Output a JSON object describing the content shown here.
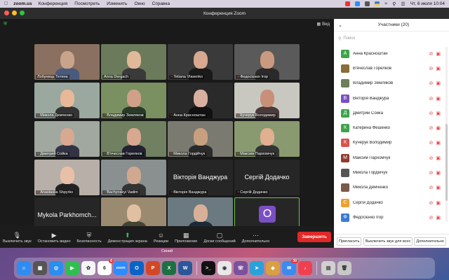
{
  "menubar": {
    "app": "zoom.us",
    "items": [
      "Конференция",
      "Посмотреть",
      "Изменить",
      "Окно",
      "Справка"
    ],
    "clock": "Чт, 6 июля 10:04"
  },
  "window": {
    "title": "Конференция Zoom",
    "view_label": "Вид"
  },
  "tiles": [
    {
      "name": "Лобунець Тетяна",
      "muted": false
    },
    {
      "name": "Anna Dergach",
      "muted": false
    },
    {
      "name": "Tetiana Vlasenko",
      "muted": true
    },
    {
      "name": "Федосієнко Ігор",
      "muted": true
    },
    {
      "name": "Микола Демченко",
      "muted": true
    },
    {
      "name": "Владимир Земляков",
      "muted": true
    },
    {
      "name": "Анна Красноштан",
      "muted": true
    },
    {
      "name": "Кучерук Володимир",
      "muted": true
    },
    {
      "name": "Дмитрий Сойка",
      "muted": true
    },
    {
      "name": "В'ячеслав Горелков",
      "muted": true
    },
    {
      "name": "Микола Гордійчук",
      "muted": true
    },
    {
      "name": "Максим Пархомчук",
      "muted": true
    },
    {
      "name": "Anastasiia Shpyrko",
      "muted": true
    },
    {
      "name": "Bachynskyi Vadim",
      "muted": true
    },
    {
      "name": "Вікторія Ванджура",
      "muted": true,
      "bigtext": "Вікторія Ванджура"
    },
    {
      "name": "Сергій Додачко",
      "muted": true,
      "bigtext": "Сергій Додачко"
    },
    {
      "name": "Mykola Parkhomchuk",
      "muted": false,
      "bigtext": "Mykola Parkhomch..."
    },
    {
      "name": "Катерина Фешенко",
      "muted": true
    },
    {
      "name": "Oleksandr Ivanov",
      "muted": true
    },
    {
      "name": "Подключение звука",
      "muted": false,
      "avatar": "O"
    }
  ],
  "toolbar": {
    "mute": "Выключить звук",
    "video": "Остановить видео",
    "security": "Безопасность",
    "share": "Демонстрация экрана",
    "reactions": "Реакции",
    "apps": "Приложение",
    "whiteboards": "Доски сообщений",
    "more": "Дополнительно",
    "end": "Завершить"
  },
  "panel": {
    "title": "Участники (20)",
    "search_placeholder": "Поиск",
    "participants": [
      {
        "initial": "А",
        "name": "Анна Красноштан",
        "color": "#3fa34d"
      },
      {
        "initial": "",
        "name": "В'ячеслав Горелков",
        "color": "#8a6d3b"
      },
      {
        "initial": "",
        "name": "Владимир Земляков",
        "color": "#6b7f5a"
      },
      {
        "initial": "В",
        "name": "Вікторія Ванджура",
        "color": "#7b4fc4"
      },
      {
        "initial": "Д",
        "name": "Дмитрий Сойка",
        "color": "#3fa34d"
      },
      {
        "initial": "К",
        "name": "Катерина Фешенко",
        "color": "#3fa34d"
      },
      {
        "initial": "К",
        "name": "Кучерук Володимир",
        "color": "#d9534f"
      },
      {
        "initial": "М",
        "name": "Максим Пархомчук",
        "color": "#8e3b2e"
      },
      {
        "initial": "",
        "name": "Микола Гордійчук",
        "color": "#555555"
      },
      {
        "initial": "",
        "name": "Микола Демченко",
        "color": "#7a5a4a"
      },
      {
        "initial": "С",
        "name": "Сергій Додачко",
        "color": "#f0a030"
      },
      {
        "initial": "Ф",
        "name": "Федосієнко Ігор",
        "color": "#3b7bd4"
      },
      {
        "initial": "MP",
        "name": "Mykola Parkhomchuk",
        "color": "#4a7bd4"
      }
    ],
    "footer": [
      "Пригласить",
      "Выключить звук для всех",
      "Дополнительно"
    ]
  },
  "dock": {
    "tooltip": "Синий",
    "apps": [
      {
        "label": "Finder",
        "color": "#2f8cf0",
        "glyph": "☺"
      },
      {
        "label": "Launchpad",
        "color": "#555",
        "glyph": "▦"
      },
      {
        "label": "Safari",
        "color": "#2a8df0",
        "glyph": "◎"
      },
      {
        "label": "FaceTime",
        "color": "#2fbf4f",
        "glyph": "▶"
      },
      {
        "label": "Photos",
        "color": "#f5f5f5",
        "glyph": "✿"
      },
      {
        "label": "Calendar",
        "color": "#ffffff",
        "glyph": "6"
      },
      {
        "label": "Zoom",
        "color": "#2d8cff",
        "glyph": "zoom"
      },
      {
        "label": "Outlook",
        "color": "#0a64c8",
        "glyph": "O"
      },
      {
        "label": "PowerPoint",
        "color": "#d24726",
        "glyph": "P"
      },
      {
        "label": "Excel",
        "color": "#1d7044",
        "glyph": "X"
      },
      {
        "label": "Word",
        "color": "#2b579a",
        "glyph": "W"
      },
      {
        "label": "Terminal",
        "color": "#111",
        "glyph": ">_"
      },
      {
        "label": "Chrome",
        "color": "#e8e8e8",
        "glyph": "◉"
      },
      {
        "label": "Viber",
        "color": "#7b519d",
        "glyph": "☏"
      },
      {
        "label": "Telegram",
        "color": "#2aa1da",
        "glyph": "➤"
      },
      {
        "label": "Preview",
        "color": "#d8a040",
        "glyph": "◈"
      },
      {
        "label": "Mail",
        "color": "#3a8af0",
        "glyph": "✉"
      },
      {
        "label": "Music",
        "color": "#f04050",
        "glyph": "♪"
      },
      {
        "label": "Documents",
        "color": "#d0d0d0",
        "glyph": "▤"
      },
      {
        "label": "Trash",
        "color": "#c8c8c8",
        "glyph": "🗑"
      }
    ],
    "calendar_badge": "6",
    "mail_badge": "30"
  }
}
